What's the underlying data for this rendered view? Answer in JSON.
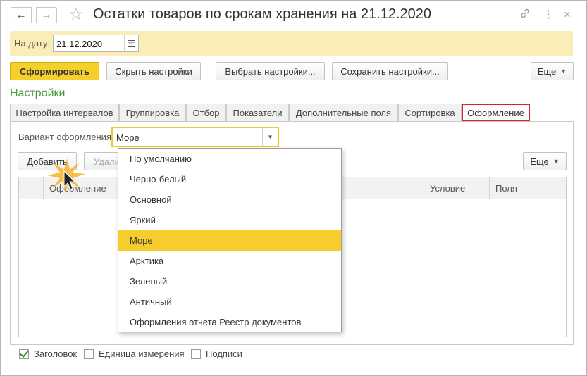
{
  "window": {
    "title": "Остатки товаров по срокам хранения на 21.12.2020",
    "icons": [
      "back-arrow-icon",
      "forward-arrow-icon",
      "star-icon",
      "link-icon",
      "more-icon",
      "close-icon"
    ]
  },
  "date_panel": {
    "label": "На дату:",
    "value": "21.12.2020"
  },
  "toolbar": {
    "generate": "Сформировать",
    "hide_settings": "Скрыть настройки",
    "choose_settings": "Выбрать настройки...",
    "save_settings": "Сохранить настройки...",
    "more": "Еще"
  },
  "settings": {
    "heading": "Настройки",
    "tabs": [
      {
        "label": "Настройка интервалов"
      },
      {
        "label": "Группировка"
      },
      {
        "label": "Отбор"
      },
      {
        "label": "Показатели"
      },
      {
        "label": "Дополнительные поля"
      },
      {
        "label": "Сортировка"
      },
      {
        "label": "Оформление",
        "active": true
      }
    ]
  },
  "appearance": {
    "variant_label": "Вариант оформления:",
    "variant_value": "Море",
    "add_button": "Добавить",
    "delete_button": "Удали",
    "more": "Еще",
    "columns": [
      "Оформление",
      "Условие",
      "Поля"
    ],
    "options": [
      "По умолчанию",
      "Черно-белый",
      "Основной",
      "Яркий",
      "Море",
      "Арктика",
      "Зеленый",
      "Античный",
      "Оформления отчета Реестр документов"
    ],
    "selected_option": "Море"
  },
  "footer": {
    "checkboxes": [
      {
        "label": "Заголовок",
        "checked": true
      },
      {
        "label": "Единица измерения",
        "checked": false
      },
      {
        "label": "Подписи",
        "checked": false
      }
    ]
  },
  "colors": {
    "accent_yellow": "#f5cf2a",
    "date_panel_bg": "#fbedb6",
    "heading_green": "#4b9a3a",
    "active_tab_border": "#d8232a"
  }
}
